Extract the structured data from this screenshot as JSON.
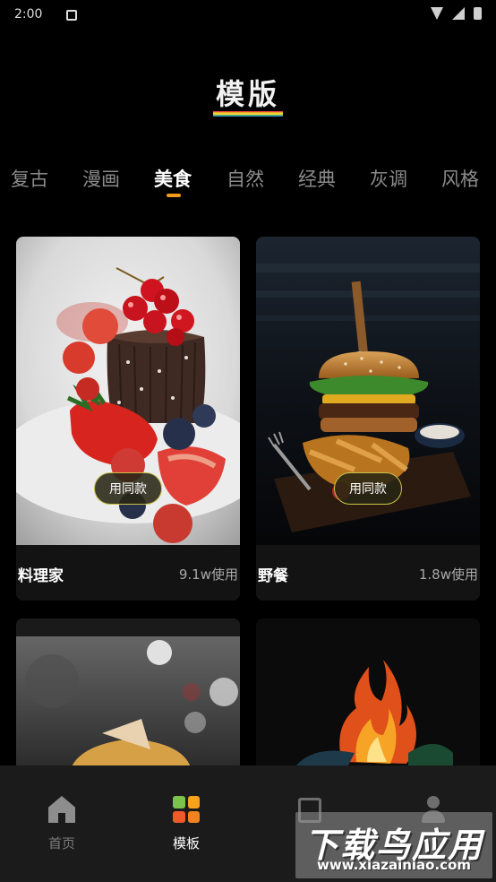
{
  "status": {
    "time": "2:00"
  },
  "header": {
    "title": "模版",
    "rainbow_colors": [
      "#e84545",
      "#f2a42a",
      "#f0d43a",
      "#49b85c",
      "#3a8fd9"
    ]
  },
  "tabs": [
    {
      "label": "复古"
    },
    {
      "label": "漫画"
    },
    {
      "label": "美食"
    },
    {
      "label": "自然"
    },
    {
      "label": "经典"
    },
    {
      "label": "灰调"
    },
    {
      "label": "风格"
    }
  ],
  "active_tab_index": 2,
  "cards": [
    {
      "name": "料理家",
      "uses": "9.1w使用",
      "button": "用同款",
      "image": "canele-dessert-with-red-currants-and-strawberries"
    },
    {
      "name": "野餐",
      "uses": "1.8w使用",
      "button": "用同款",
      "image": "burger-with-fries-on-dark-table"
    },
    {
      "image": "sandwich-with-bokeh-background"
    },
    {
      "image": "flaming-grill"
    }
  ],
  "bottom_nav": [
    {
      "label": "首页",
      "icon": "home-icon"
    },
    {
      "label": "模板",
      "icon": "templates-grid-icon"
    },
    {
      "label": "",
      "icon": "gallery-icon"
    },
    {
      "label": "",
      "icon": "profile-icon"
    }
  ],
  "active_nav_index": 1,
  "template_icon_colors": [
    "#7bc34a",
    "#f7a21b",
    "#ef5a2a",
    "#f0831e"
  ],
  "accent_color": "#f39a1e",
  "watermark": {
    "main": "下载鸟应用",
    "sub": "www.xiazainiao.com"
  }
}
